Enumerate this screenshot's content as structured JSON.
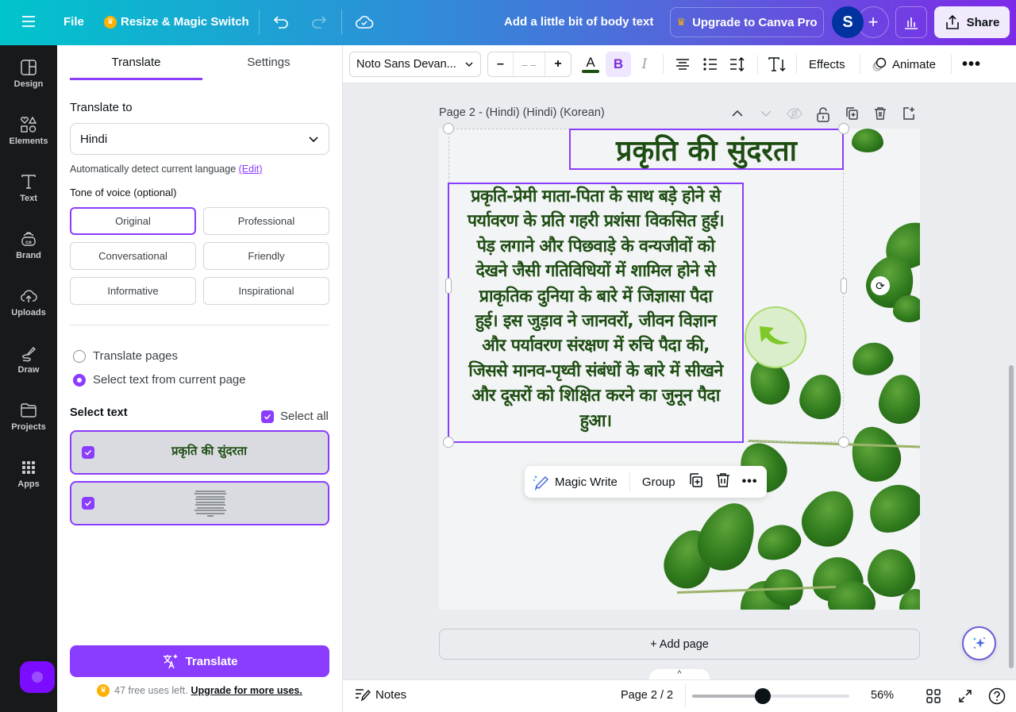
{
  "topbar": {
    "file_label": "File",
    "resize_label": "Resize & Magic Switch",
    "doc_title": "Add a little bit of body text",
    "upgrade_label": "Upgrade to Canva Pro",
    "avatar_initial": "S",
    "share_label": "Share"
  },
  "rail": {
    "items": [
      {
        "label": "Design",
        "icon": "design-icon"
      },
      {
        "label": "Elements",
        "icon": "elements-icon"
      },
      {
        "label": "Text",
        "icon": "text-icon"
      },
      {
        "label": "Brand",
        "icon": "brand-icon"
      },
      {
        "label": "Uploads",
        "icon": "uploads-icon"
      },
      {
        "label": "Draw",
        "icon": "draw-icon"
      },
      {
        "label": "Projects",
        "icon": "projects-icon"
      },
      {
        "label": "Apps",
        "icon": "apps-icon"
      }
    ]
  },
  "panel": {
    "tabs": [
      {
        "label": "Translate",
        "active": true
      },
      {
        "label": "Settings",
        "active": false
      }
    ],
    "translate_to_label": "Translate to",
    "language_value": "Hindi",
    "detect_hint": "Automatically detect current language",
    "edit_link": "(Edit)",
    "tone_label": "Tone of voice (optional)",
    "tones": [
      {
        "label": "Original",
        "active": true
      },
      {
        "label": "Professional",
        "active": false
      },
      {
        "label": "Conversational",
        "active": false
      },
      {
        "label": "Friendly",
        "active": false
      },
      {
        "label": "Informative",
        "active": false
      },
      {
        "label": "Inspirational",
        "active": false
      }
    ],
    "radio_options": [
      {
        "label": "Translate pages",
        "selected": false
      },
      {
        "label": "Select text from current page",
        "selected": true
      }
    ],
    "select_text_label": "Select text",
    "select_all_label": "Select all",
    "select_all_checked": true,
    "text_items": [
      {
        "text": "प्रकृति की सुंदरता",
        "checked": true
      },
      {
        "text": "",
        "checked": true
      }
    ],
    "translate_button": "Translate",
    "free_uses": "47 free uses left.",
    "upgrade_link": "Upgrade for more uses."
  },
  "toolbar": {
    "font_name": "Noto Sans Devan...",
    "font_size": "– –",
    "minus": "–",
    "plus": "+",
    "text_color": "#1e4d12",
    "bold_label": "B",
    "italic_label": "I",
    "effects_label": "Effects",
    "animate_label": "Animate"
  },
  "canvas": {
    "page_label": "Page 2 - (Hindi) (Hindi) (Korean)",
    "heading": "प्रकृति की सुंदरता",
    "body_lines": [
      "प्रकृति-प्रेमी माता-पिता के साथ बड़े होने से",
      "पर्यावरण के प्रति गहरी प्रशंसा विकसित हुई।",
      "पेड़ लगाने और पिछवाड़े के वन्यजीवों को",
      "देखने जैसी गतिविधियों में शामिल होने से",
      "प्राकृतिक दुनिया के बारे में जिज्ञासा पैदा",
      "हुई। इस जुड़ाव ने जानवरों, जीवन विज्ञान",
      "और पर्यावरण संरक्षण में रुचि पैदा की,",
      "जिससे मानव-पृथ्वी संबंधों के बारे में सीखने",
      "और दूसरों को शिक्षित करने का जुनून पैदा",
      "हुआ।"
    ],
    "text_color": "#1e4d12",
    "float_menu": {
      "magic_write": "Magic Write",
      "group": "Group"
    },
    "add_page": "+ Add page"
  },
  "footer": {
    "notes_label": "Notes",
    "page_count": "Page 2 / 2",
    "zoom_percent": 56,
    "zoom_label": "56%",
    "zoom_slider_fraction": 0.45
  },
  "colors": {
    "accent": "#8b3dff",
    "heading_text": "#1e4d12"
  }
}
